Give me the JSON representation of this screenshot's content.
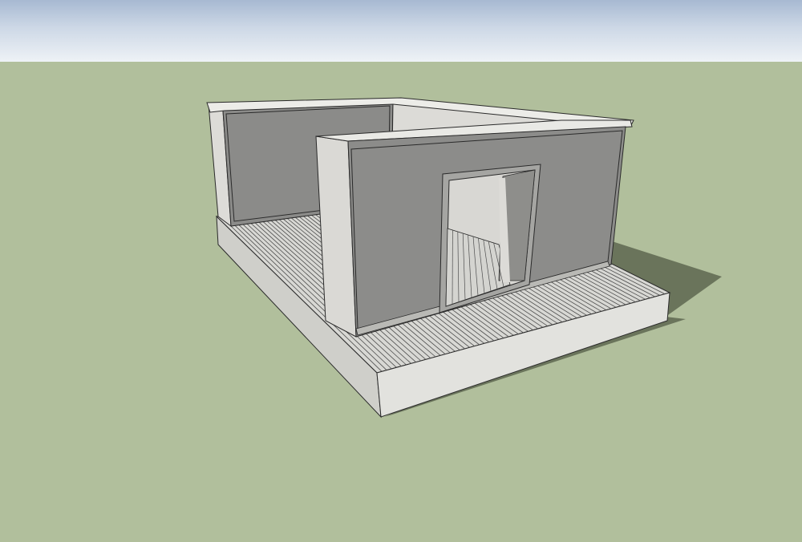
{
  "viewport": {
    "sky_color_top": "#a7b9d2",
    "sky_color_bottom": "#eef2f6",
    "ground_color": "#b1bf9c"
  },
  "model": {
    "subject": "room-on-deck",
    "colors": {
      "shadow": "#6a745b",
      "face_light": "#dcdbd6",
      "face_mid": "#c9c8c3",
      "face_dark": "#8e8e8c",
      "face_front": "#8a8a88",
      "top_face": "#e8e8e4",
      "edge": "#2a2a2a",
      "floor": "#d6d6d2",
      "floor_plank": "#5a5a5a"
    }
  }
}
